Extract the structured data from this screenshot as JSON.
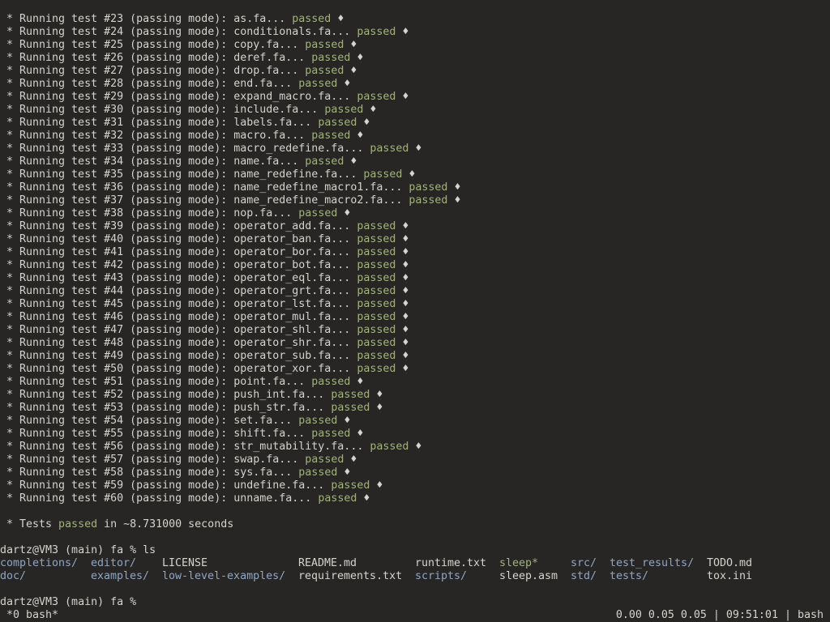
{
  "test_prefix": "* Running test ",
  "test_mode": " (passing mode): ",
  "passed_label": "passed",
  "diamond": "♦",
  "tests": [
    {
      "num": "#23",
      "file": "as.fa..."
    },
    {
      "num": "#24",
      "file": "conditionals.fa..."
    },
    {
      "num": "#25",
      "file": "copy.fa..."
    },
    {
      "num": "#26",
      "file": "deref.fa..."
    },
    {
      "num": "#27",
      "file": "drop.fa..."
    },
    {
      "num": "#28",
      "file": "end.fa..."
    },
    {
      "num": "#29",
      "file": "expand_macro.fa..."
    },
    {
      "num": "#30",
      "file": "include.fa..."
    },
    {
      "num": "#31",
      "file": "labels.fa..."
    },
    {
      "num": "#32",
      "file": "macro.fa..."
    },
    {
      "num": "#33",
      "file": "macro_redefine.fa..."
    },
    {
      "num": "#34",
      "file": "name.fa..."
    },
    {
      "num": "#35",
      "file": "name_redefine.fa..."
    },
    {
      "num": "#36",
      "file": "name_redefine_macro1.fa..."
    },
    {
      "num": "#37",
      "file": "name_redefine_macro2.fa..."
    },
    {
      "num": "#38",
      "file": "nop.fa..."
    },
    {
      "num": "#39",
      "file": "operator_add.fa..."
    },
    {
      "num": "#40",
      "file": "operator_ban.fa..."
    },
    {
      "num": "#41",
      "file": "operator_bor.fa..."
    },
    {
      "num": "#42",
      "file": "operator_bot.fa..."
    },
    {
      "num": "#43",
      "file": "operator_eql.fa..."
    },
    {
      "num": "#44",
      "file": "operator_grt.fa..."
    },
    {
      "num": "#45",
      "file": "operator_lst.fa..."
    },
    {
      "num": "#46",
      "file": "operator_mul.fa..."
    },
    {
      "num": "#47",
      "file": "operator_shl.fa..."
    },
    {
      "num": "#48",
      "file": "operator_shr.fa..."
    },
    {
      "num": "#49",
      "file": "operator_sub.fa..."
    },
    {
      "num": "#50",
      "file": "operator_xor.fa..."
    },
    {
      "num": "#51",
      "file": "point.fa..."
    },
    {
      "num": "#52",
      "file": "push_int.fa..."
    },
    {
      "num": "#53",
      "file": "push_str.fa..."
    },
    {
      "num": "#54",
      "file": "set.fa..."
    },
    {
      "num": "#55",
      "file": "shift.fa..."
    },
    {
      "num": "#56",
      "file": "str_mutability.fa..."
    },
    {
      "num": "#57",
      "file": "swap.fa..."
    },
    {
      "num": "#58",
      "file": "sys.fa..."
    },
    {
      "num": "#59",
      "file": "undefine.fa..."
    },
    {
      "num": "#60",
      "file": "unname.fa..."
    }
  ],
  "summary": {
    "prefix": "* Tests ",
    "passed": "passed",
    "suffix": " in ~8.731000 seconds"
  },
  "prompt1": "dartz@VM3 (main) fa % ls",
  "ls": [
    {
      "name": "completions/",
      "kind": "dir",
      "col": 0,
      "row": 0
    },
    {
      "name": "doc/",
      "kind": "dir",
      "col": 0,
      "row": 1
    },
    {
      "name": "editor/",
      "kind": "dir",
      "col": 1,
      "row": 0
    },
    {
      "name": "examples/",
      "kind": "dir",
      "col": 1,
      "row": 1
    },
    {
      "name": "LICENSE",
      "kind": "file",
      "col": 2,
      "row": 0
    },
    {
      "name": "low-level-examples/",
      "kind": "dir",
      "col": 2,
      "row": 1
    },
    {
      "name": "README.md",
      "kind": "file",
      "col": 3,
      "row": 0
    },
    {
      "name": "requirements.txt",
      "kind": "file",
      "col": 3,
      "row": 1
    },
    {
      "name": "runtime.txt",
      "kind": "file",
      "col": 4,
      "row": 0
    },
    {
      "name": "scripts/",
      "kind": "dir",
      "col": 4,
      "row": 1
    },
    {
      "name": "sleep*",
      "kind": "exec",
      "col": 5,
      "row": 0
    },
    {
      "name": "sleep.asm",
      "kind": "file",
      "col": 5,
      "row": 1
    },
    {
      "name": "src/",
      "kind": "dir",
      "col": 6,
      "row": 0
    },
    {
      "name": "std/",
      "kind": "dir",
      "col": 6,
      "row": 1
    },
    {
      "name": "test_results/",
      "kind": "dir",
      "col": 7,
      "row": 0
    },
    {
      "name": "tests/",
      "kind": "dir",
      "col": 7,
      "row": 1
    },
    {
      "name": "TODO.md",
      "kind": "file",
      "col": 8,
      "row": 0
    },
    {
      "name": "tox.ini",
      "kind": "file",
      "col": 8,
      "row": 1
    }
  ],
  "prompt2": "dartz@VM3 (main) fa %",
  "status": {
    "left": "*0 bash*",
    "right": "0.00 0.05 0.05 | 09:51:01 | bash"
  }
}
